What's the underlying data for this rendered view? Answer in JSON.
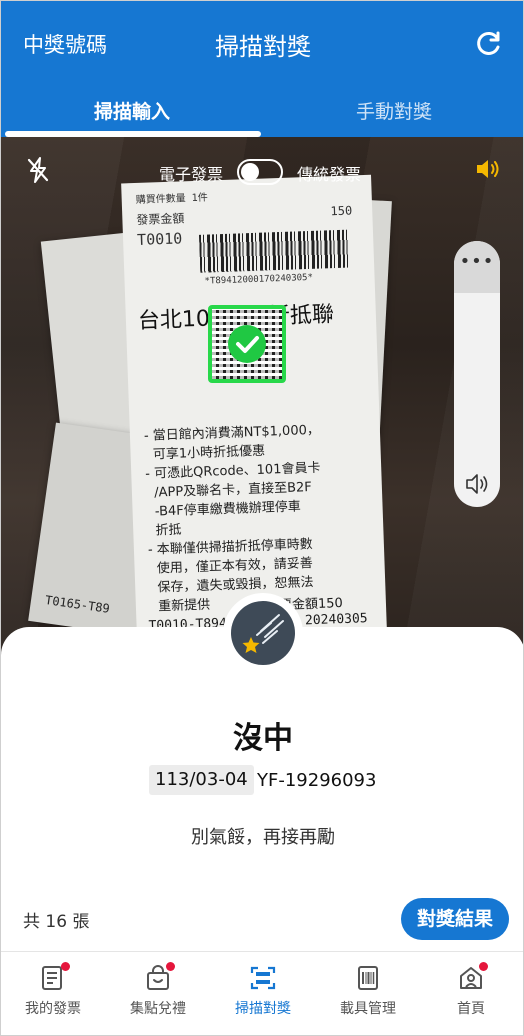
{
  "header": {
    "left_label": "中獎號碼",
    "title": "掃描對獎",
    "refresh_icon": "refresh-icon"
  },
  "tabs": [
    {
      "label": "掃描輸入",
      "active": true
    },
    {
      "label": "手動對獎",
      "active": false
    }
  ],
  "camera": {
    "flash_icon": "flash-off-icon",
    "toggle_left_label": "電子發票",
    "toggle_right_label": "傳統發票",
    "toggle_state": "off",
    "sound_icon": "speaker-icon",
    "volume_more": "•••",
    "receipt": {
      "top_small": "購買件數量 1件",
      "amount_label": "發票金額",
      "amount": "150",
      "code": "T0010",
      "barcode_text": "*T89412000170240305*",
      "title": "台北101停車折抵聯",
      "body": "- 當日館內消費滿NT$1,000，\n  可享1小時折抵優惠\n- 可憑此QRcode、101會員卡\n  /APP及聯名卡，直接至B2F\n  -B4F停車繳費機辦理停車\n  折抵\n- 本聯僅供掃描折抵停車時數\n  使用，僅正本有效，請妥善\n  保存，遺失或毀損，恕無法\n  重新提供",
      "footer_amount": "發票金額150",
      "footer_code": "T0010-T89412-000170 20240305",
      "bg_fragment": "T0165-T89"
    }
  },
  "result": {
    "status": "沒中",
    "date": "113/03-04",
    "invoice_number": "YF-19296093",
    "message": "別氣餒，再接再勵",
    "count": "共 16 張",
    "button_label": "對獎結果"
  },
  "nav": [
    {
      "label": "我的發票",
      "icon": "invoice-icon",
      "dot": true,
      "active": false
    },
    {
      "label": "集點兌禮",
      "icon": "gift-bag-icon",
      "dot": true,
      "active": false
    },
    {
      "label": "掃描對獎",
      "icon": "scan-icon",
      "dot": false,
      "active": true
    },
    {
      "label": "載具管理",
      "icon": "barcode-card-icon",
      "dot": false,
      "active": false
    },
    {
      "label": "首頁",
      "icon": "home-icon",
      "dot": true,
      "active": false
    }
  ],
  "colors": {
    "brand_blue": "#1677d2",
    "qr_green": "#28d84a",
    "sound_yellow": "#f5b800",
    "notify_red": "#e5163c"
  }
}
